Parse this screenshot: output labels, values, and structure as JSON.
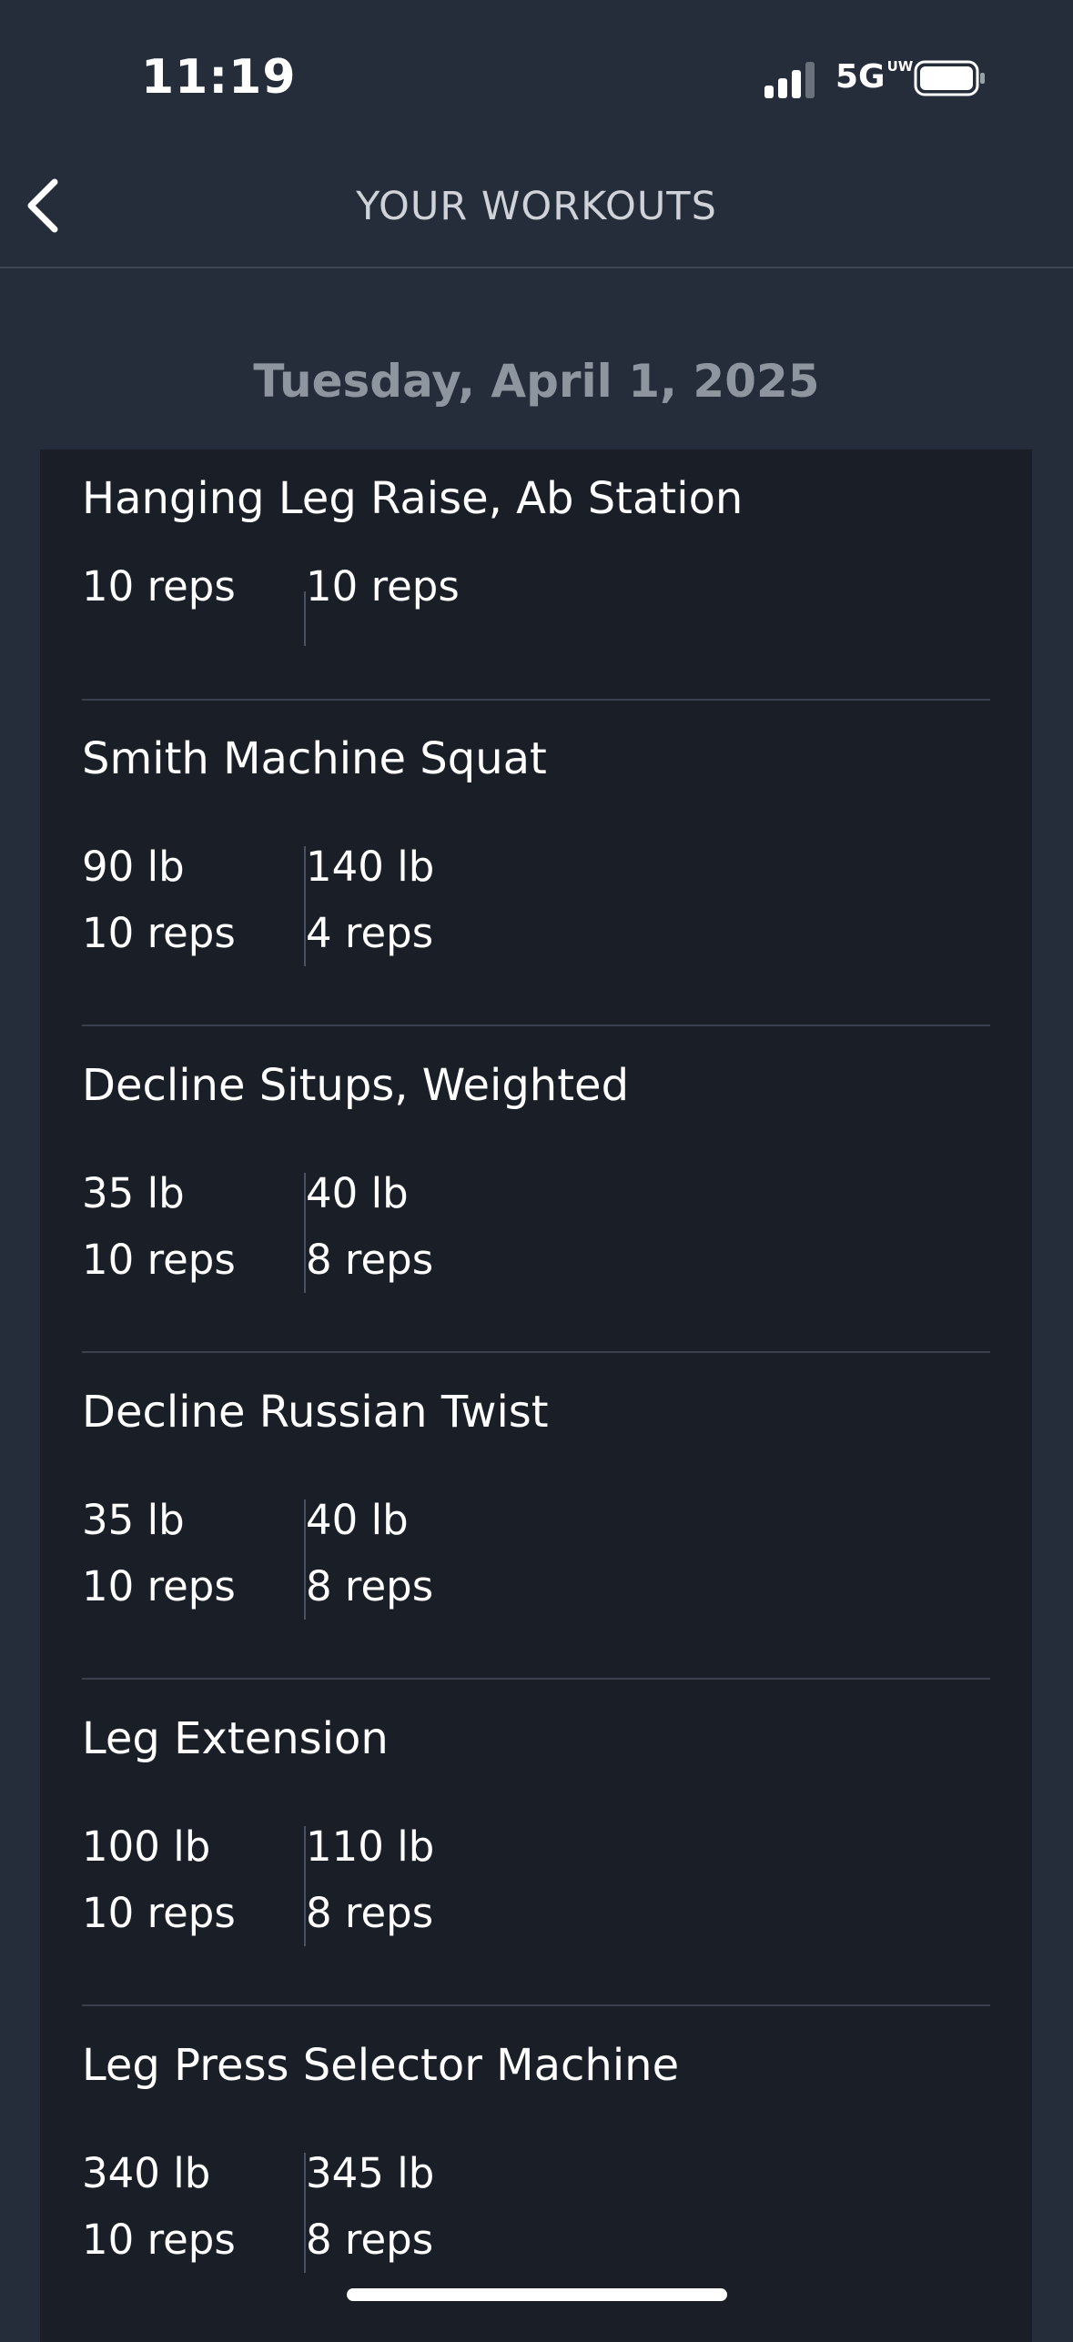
{
  "status_bar": {
    "time": "11:19",
    "network": "5G",
    "network_suffix": "UW"
  },
  "header": {
    "title": "YOUR WORKOUTS"
  },
  "date": "Tuesday, April 1, 2025",
  "exercises": [
    {
      "name": "Hanging Leg Raise, Ab Station",
      "sets": [
        {
          "weight": "",
          "reps": "10 reps"
        },
        {
          "weight": "",
          "reps": "10 reps"
        }
      ]
    },
    {
      "name": "Smith Machine Squat",
      "sets": [
        {
          "weight": "90 lb",
          "reps": "10 reps"
        },
        {
          "weight": "140 lb",
          "reps": "4 reps"
        }
      ]
    },
    {
      "name": "Decline Situps, Weighted",
      "sets": [
        {
          "weight": "35 lb",
          "reps": "10 reps"
        },
        {
          "weight": "40 lb",
          "reps": "8 reps"
        }
      ]
    },
    {
      "name": "Decline Russian Twist",
      "sets": [
        {
          "weight": "35 lb",
          "reps": "10 reps"
        },
        {
          "weight": "40 lb",
          "reps": "8 reps"
        }
      ]
    },
    {
      "name": "Leg Extension",
      "sets": [
        {
          "weight": "100 lb",
          "reps": "10 reps"
        },
        {
          "weight": "110 lb",
          "reps": "8 reps"
        }
      ]
    },
    {
      "name": "Leg Press Selector Machine",
      "sets": [
        {
          "weight": "340 lb",
          "reps": "10 reps"
        },
        {
          "weight": "345 lb",
          "reps": "8 reps"
        }
      ]
    }
  ],
  "icons": {
    "back": "chevron-left-icon",
    "signal": "signal-bars-icon",
    "battery": "battery-icon"
  },
  "colors": {
    "background": "#252d3a",
    "card": "#1a1f27",
    "divider": "#3a414d",
    "date_text": "#8f959e"
  }
}
